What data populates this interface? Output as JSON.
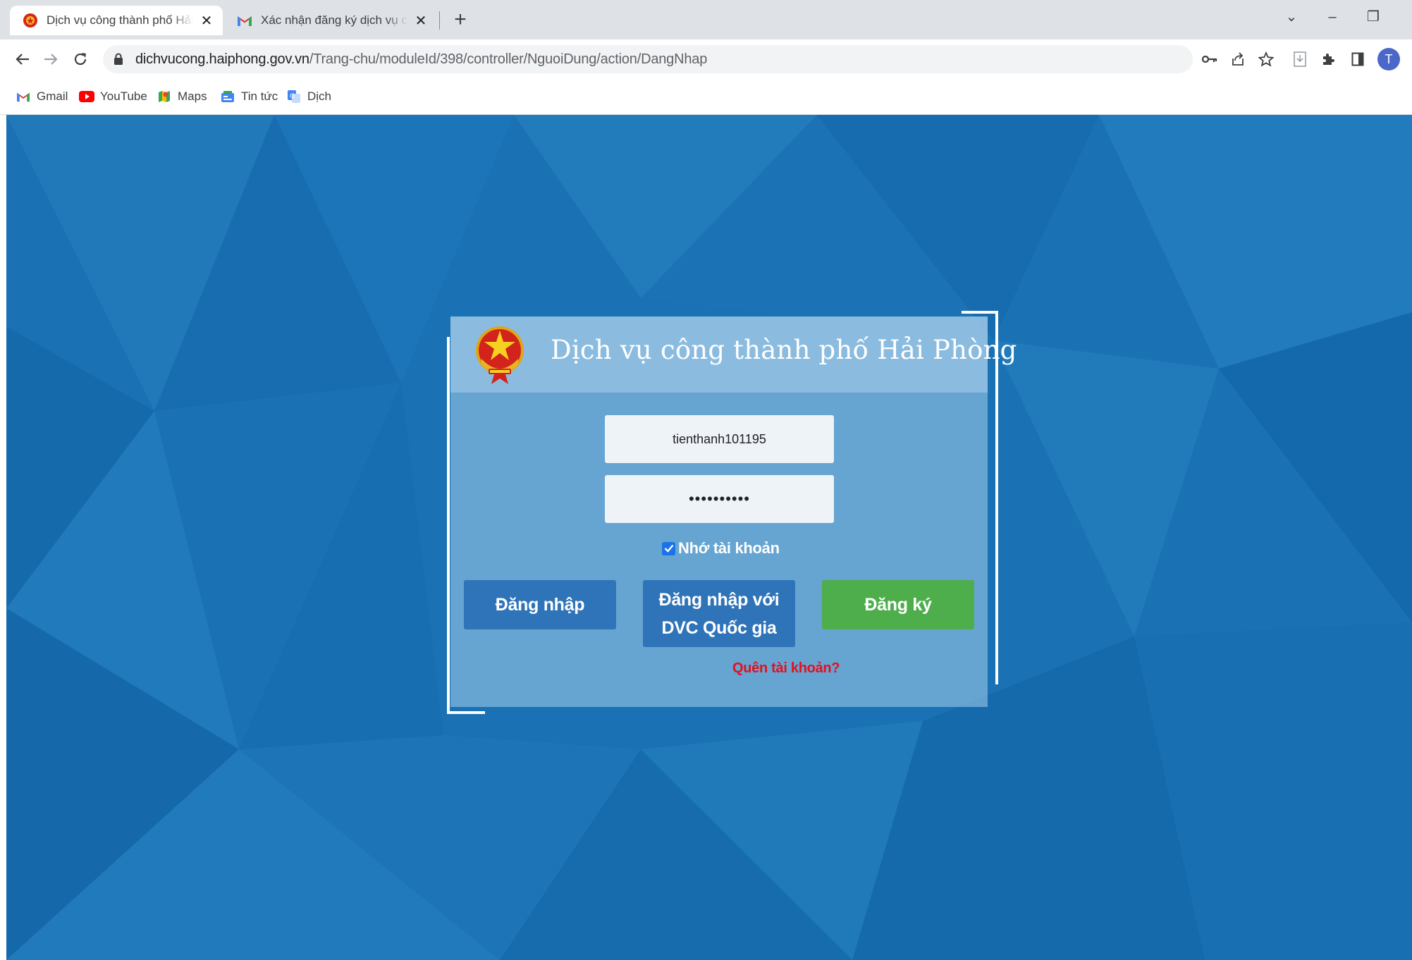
{
  "browser": {
    "tabs": [
      {
        "title": "Dịch vụ công thành phố Hải Phòng",
        "active": true,
        "icon": "emblem-favicon"
      },
      {
        "title": "Xác nhận đăng ký dịch vụ công trực tuyến",
        "active": false,
        "icon": "gmail-icon"
      }
    ],
    "new_tab_label": "+",
    "window_controls": {
      "dropdown": "⌄",
      "minimize": "–",
      "restore": "❐"
    },
    "url_host": "dichvucong.haiphong.gov.vn",
    "url_path": "/Trang-chu/moduleId/398/controller/NguoiDung/action/DangNhap",
    "profile_initial": "T",
    "bookmarks": [
      {
        "label": "Gmail",
        "icon": "gmail-icon"
      },
      {
        "label": "YouTube",
        "icon": "youtube-icon"
      },
      {
        "label": "Maps",
        "icon": "maps-icon"
      },
      {
        "label": "Tin tức",
        "icon": "news-icon"
      },
      {
        "label": "Dịch",
        "icon": "translate-icon"
      }
    ]
  },
  "login": {
    "title": "Dịch vụ công thành phố Hải Phòng",
    "username_value": "tienthanh101195",
    "password_value": "••••••••••",
    "remember_label": "Nhớ tài khoản",
    "remember_checked": true,
    "login_button": "Đăng nhập",
    "national_button": "Đăng nhập với\nDVC Quốc gia",
    "register_button": "Đăng ký",
    "forgot_link": "Quên tài khoản?"
  },
  "colors": {
    "background": "#1a71b3",
    "button_blue": "#2f74b8",
    "button_green": "#4fae4c",
    "forgot_red": "#e3101d"
  }
}
